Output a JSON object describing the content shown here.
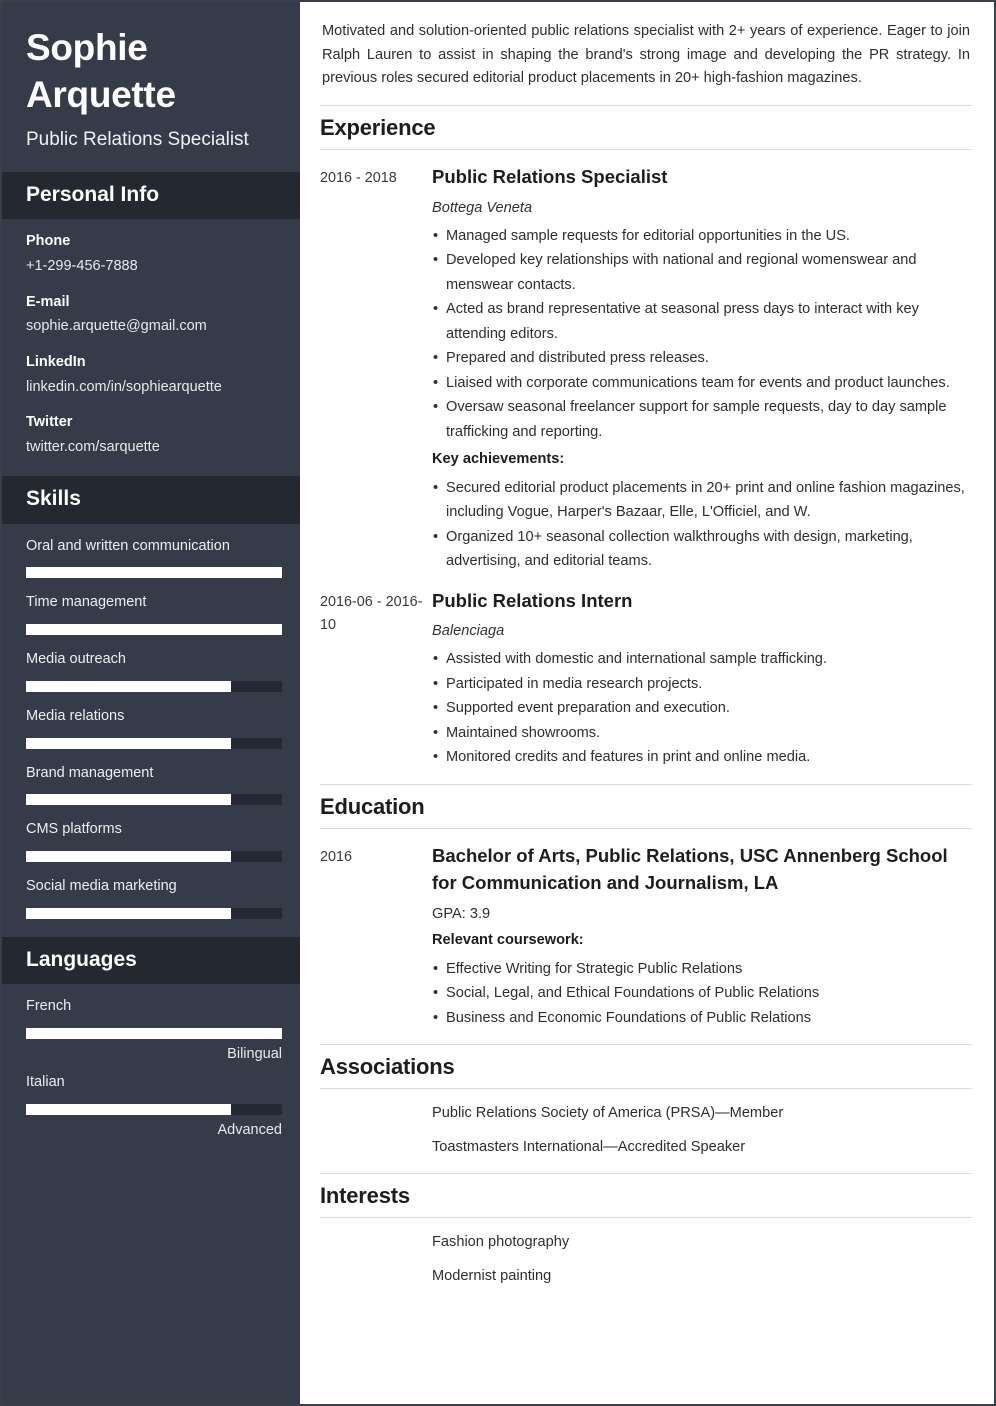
{
  "sidebar": {
    "name": "Sophie Arquette",
    "job_title": "Public Relations Specialist",
    "sections": {
      "personal_info": "Personal Info",
      "skills": "Skills",
      "languages": "Languages"
    },
    "contacts": [
      {
        "label": "Phone",
        "value": "+1-299-456-7888"
      },
      {
        "label": "E-mail",
        "value": "sophie.arquette@gmail.com"
      },
      {
        "label": "LinkedIn",
        "value": "linkedin.com/in/sophiearquette"
      },
      {
        "label": "Twitter",
        "value": "twitter.com/sarquette"
      }
    ],
    "skills": [
      {
        "name": "Oral and written communication",
        "level": 100
      },
      {
        "name": "Time management",
        "level": 100
      },
      {
        "name": "Media outreach",
        "level": 80
      },
      {
        "name": "Media relations",
        "level": 80
      },
      {
        "name": "Brand management",
        "level": 80
      },
      {
        "name": "CMS platforms",
        "level": 80
      },
      {
        "name": "Social media marketing",
        "level": 80
      }
    ],
    "languages": [
      {
        "name": "French",
        "level": 100,
        "proficiency": "Bilingual"
      },
      {
        "name": "Italian",
        "level": 80,
        "proficiency": "Advanced"
      }
    ]
  },
  "main": {
    "summary": "Motivated and solution-oriented public relations specialist with 2+ years of experience. Eager to join Ralph Lauren to assist in shaping the brand's strong image and developing the PR strategy. In previous roles secured editorial product placements in 20+ high-fashion magazines.",
    "headings": {
      "experience": "Experience",
      "education": "Education",
      "associations": "Associations",
      "interests": "Interests"
    },
    "experience": [
      {
        "date": "2016 - 2018",
        "title": "Public Relations Specialist",
        "company": "Bottega Veneta",
        "bullets": [
          "Managed sample requests for editorial opportunities in the US.",
          "Developed key relationships with national and regional womenswear and menswear contacts.",
          "Acted as brand representative at seasonal press days to interact with key attending editors.",
          "Prepared and distributed press releases.",
          "Liaised with corporate communications team for events and product launches.",
          "Oversaw seasonal freelancer support for sample requests, day to day sample trafficking and reporting."
        ],
        "achievements_label": "Key achievements:",
        "achievements": [
          "Secured editorial product placements in 20+ print and online fashion magazines, including Vogue, Harper's Bazaar, Elle, L'Officiel, and W.",
          "Organized 10+ seasonal collection walkthroughs with design, marketing, advertising, and editorial teams."
        ]
      },
      {
        "date": "2016-06 - 2016-10",
        "title": "Public Relations Intern",
        "company": "Balenciaga",
        "bullets": [
          "Assisted with domestic and international sample trafficking.",
          "Participated in media research projects.",
          "Supported event preparation and execution.",
          "Maintained showrooms.",
          "Monitored credits and features in print and online media."
        ]
      }
    ],
    "education": [
      {
        "date": "2016",
        "title": "Bachelor of Arts, Public Relations,   USC Annenberg School for Communication and Journalism, LA",
        "gpa": "GPA: 3.9",
        "coursework_label": "Relevant coursework:",
        "coursework": [
          "Effective Writing for Strategic Public Relations",
          "Social, Legal, and Ethical Foundations of Public Relations",
          "Business and Economic Foundations of Public Relations"
        ]
      }
    ],
    "associations": [
      "Public Relations Society of America (PRSA)—Member",
      "Toastmasters International—Accredited Speaker"
    ],
    "interests": [
      "Fashion photography",
      "Modernist painting"
    ]
  }
}
